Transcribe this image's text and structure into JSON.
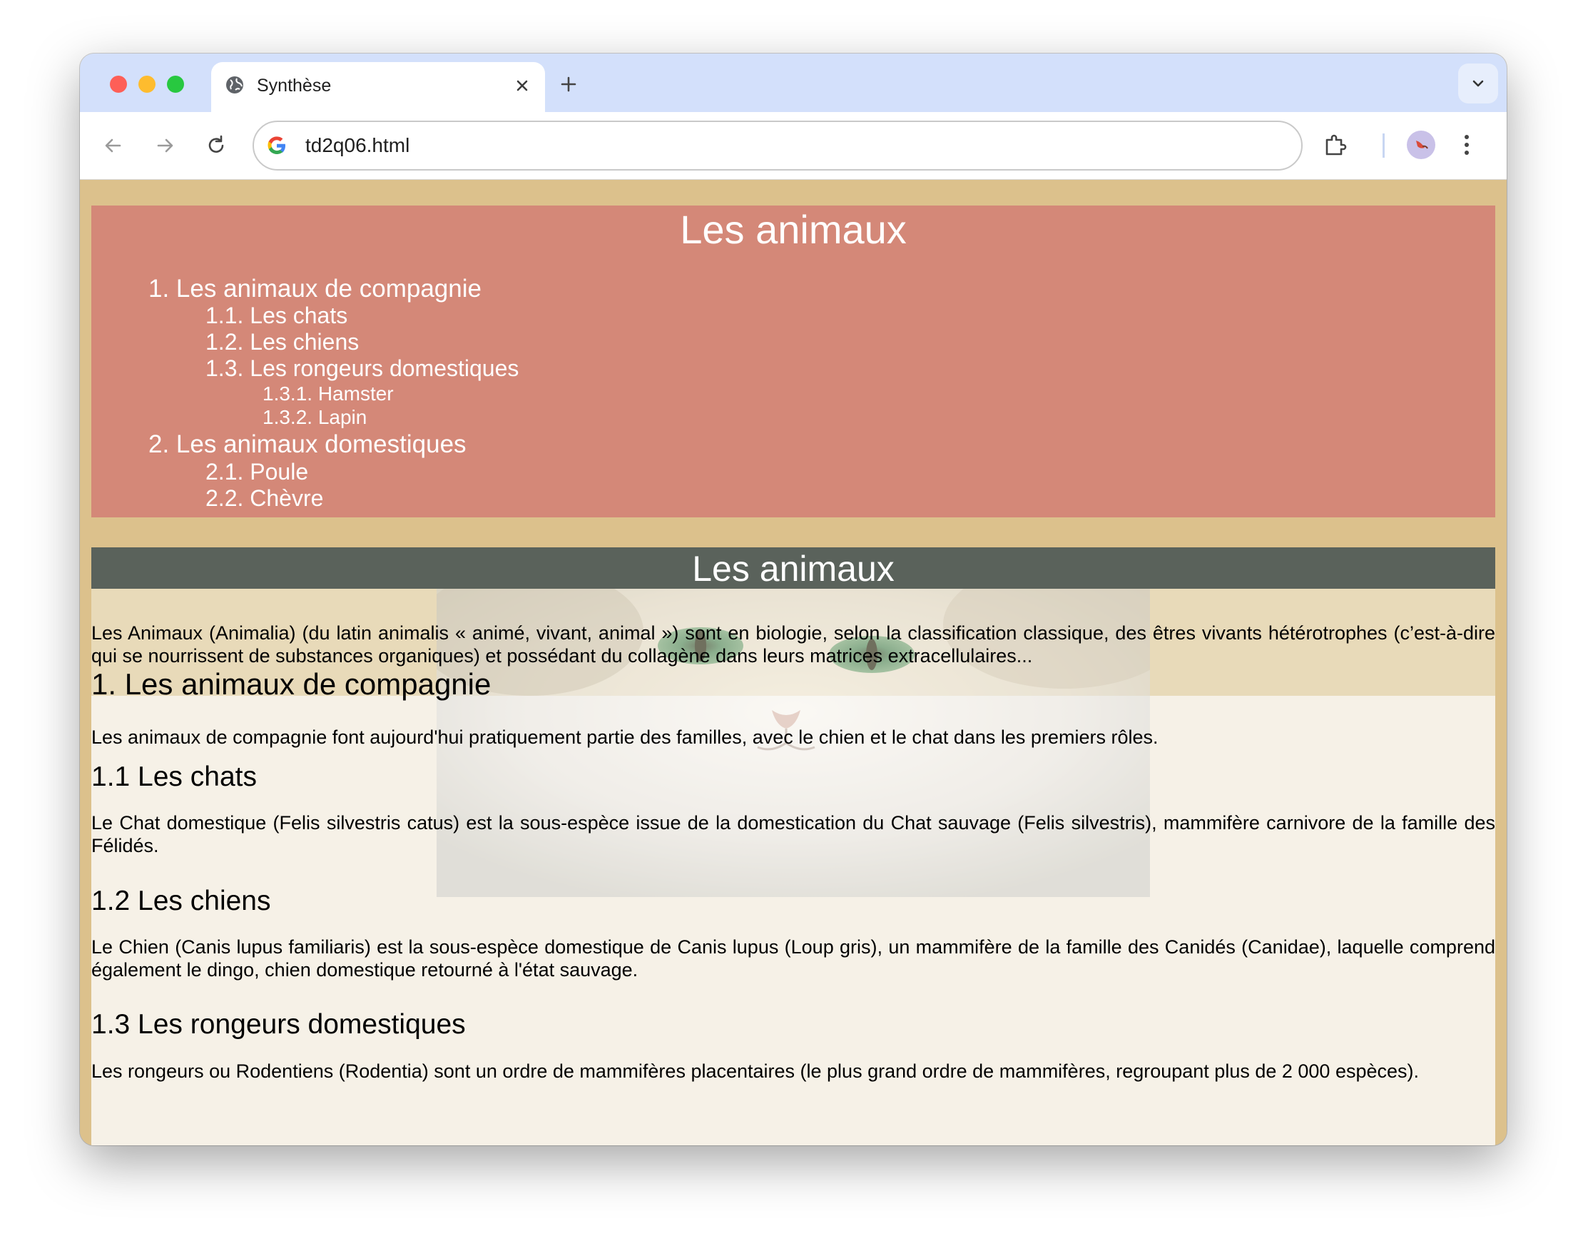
{
  "browser": {
    "tab_title": "Synthèse",
    "url": "td2q06.html"
  },
  "colors": {
    "page_background": "#dcc18c",
    "toc_background": "#d48878",
    "header_band": "#5a625b",
    "content_background": "#f6f1e7",
    "intro_band": "#e8dab9",
    "tab_strip": "#d3e0fb"
  },
  "toc": {
    "title": "Les animaux",
    "items": [
      {
        "label": "1. Les animaux de compagnie",
        "level": 1
      },
      {
        "label": "1.1. Les chats",
        "level": 2
      },
      {
        "label": "1.2. Les chiens",
        "level": 2
      },
      {
        "label": "1.3. Les rongeurs domestiques",
        "level": 2
      },
      {
        "label": "1.3.1. Hamster",
        "level": 3
      },
      {
        "label": "1.3.2. Lapin",
        "level": 3
      },
      {
        "label": "2. Les animaux domestiques",
        "level": 1
      },
      {
        "label": "2.1. Poule",
        "level": 2
      },
      {
        "label": "2.2. Chèvre",
        "level": 2
      }
    ]
  },
  "article": {
    "title": "Les animaux",
    "intro": "Les Animaux (Animalia) (du latin animalis « animé, vivant, animal ») sont en biologie, selon la classification classique, des êtres vivants hétérotrophes (c’est-à-dire qui se nourrissent de substances organiques) et possédant du collagène dans leurs matrices extracellulaires...",
    "section1": {
      "heading": "1. Les animaux de compagnie",
      "text": "Les animaux de compagnie font aujourd'hui pratiquement partie des familles, avec le chien et le chat dans les premiers rôles."
    },
    "chats": {
      "heading": "1.1 Les chats",
      "text": "Le Chat domestique (Felis silvestris catus) est la sous-espèce issue de la domestication du Chat sauvage (Felis silvestris), mammifère carnivore de la famille des Félidés."
    },
    "chiens": {
      "heading": "1.2 Les chiens",
      "text": "Le Chien (Canis lupus familiaris) est la sous-espèce domestique de Canis lupus (Loup gris), un mammifère de la famille des Canidés (Canidae), laquelle comprend également le dingo, chien domestique retourné à l'état sauvage."
    },
    "rongeurs": {
      "heading": "1.3 Les rongeurs domestiques",
      "text": "Les rongeurs ou Rodentiens (Rodentia) sont un ordre de mammifères placentaires (le plus grand ordre de mammifères, regroupant plus de 2 000 espèces)."
    }
  }
}
